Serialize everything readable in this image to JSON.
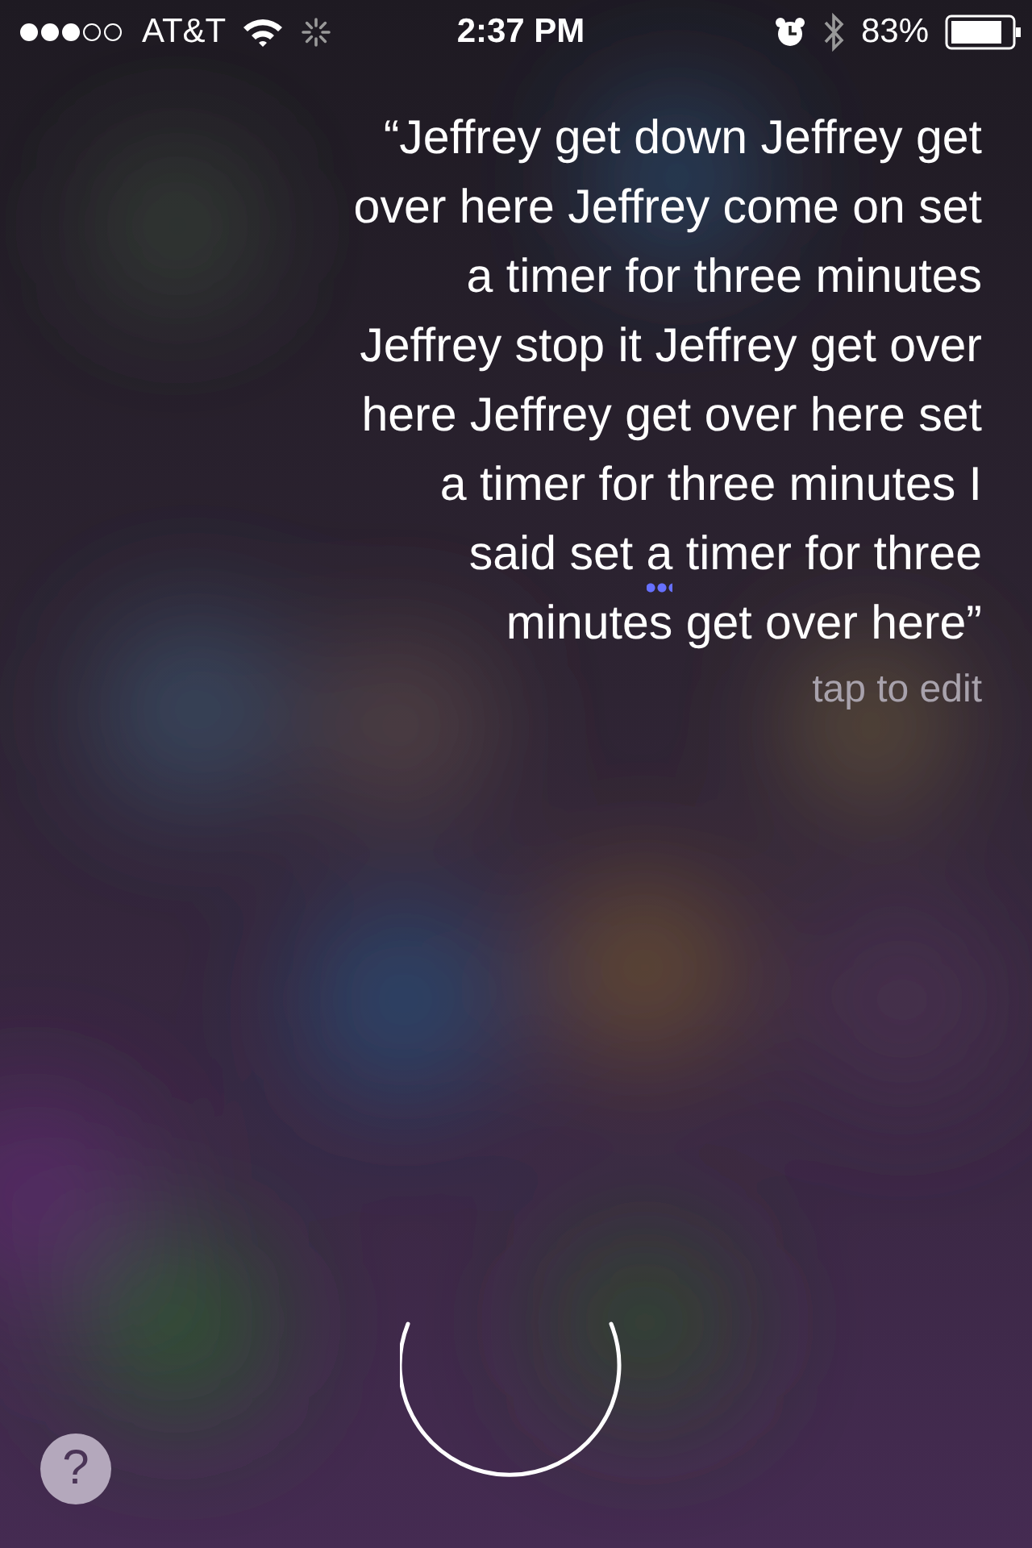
{
  "status_bar": {
    "carrier": "AT&T",
    "time": "2:37 PM",
    "battery": "83%"
  },
  "quote": {
    "lines": [
      [
        {
          "text": "“Jeffrey get down Jeffrey get",
          "flagged": false
        }
      ],
      [
        {
          "text": "over here Jeffrey come on set",
          "flagged": false
        }
      ],
      [
        {
          "text": "a timer for three minutes",
          "flagged": false
        }
      ],
      [
        {
          "text": "Jeffrey stop it Jeffrey get over",
          "flagged": false
        }
      ],
      [
        {
          "text": "here Jeffrey get over here set",
          "flagged": false
        }
      ],
      [
        {
          "text": "a timer for three minutes I",
          "flagged": false
        }
      ],
      [
        {
          "text": "said set ",
          "flagged": false
        },
        {
          "text": "a",
          "flagged": true
        },
        {
          "text": " timer for three",
          "flagged": false
        }
      ],
      [
        {
          "text": "minutes get over here”",
          "flagged": false
        }
      ]
    ]
  },
  "edit_hint": "tap to edit",
  "help_button": {
    "label": "?"
  }
}
